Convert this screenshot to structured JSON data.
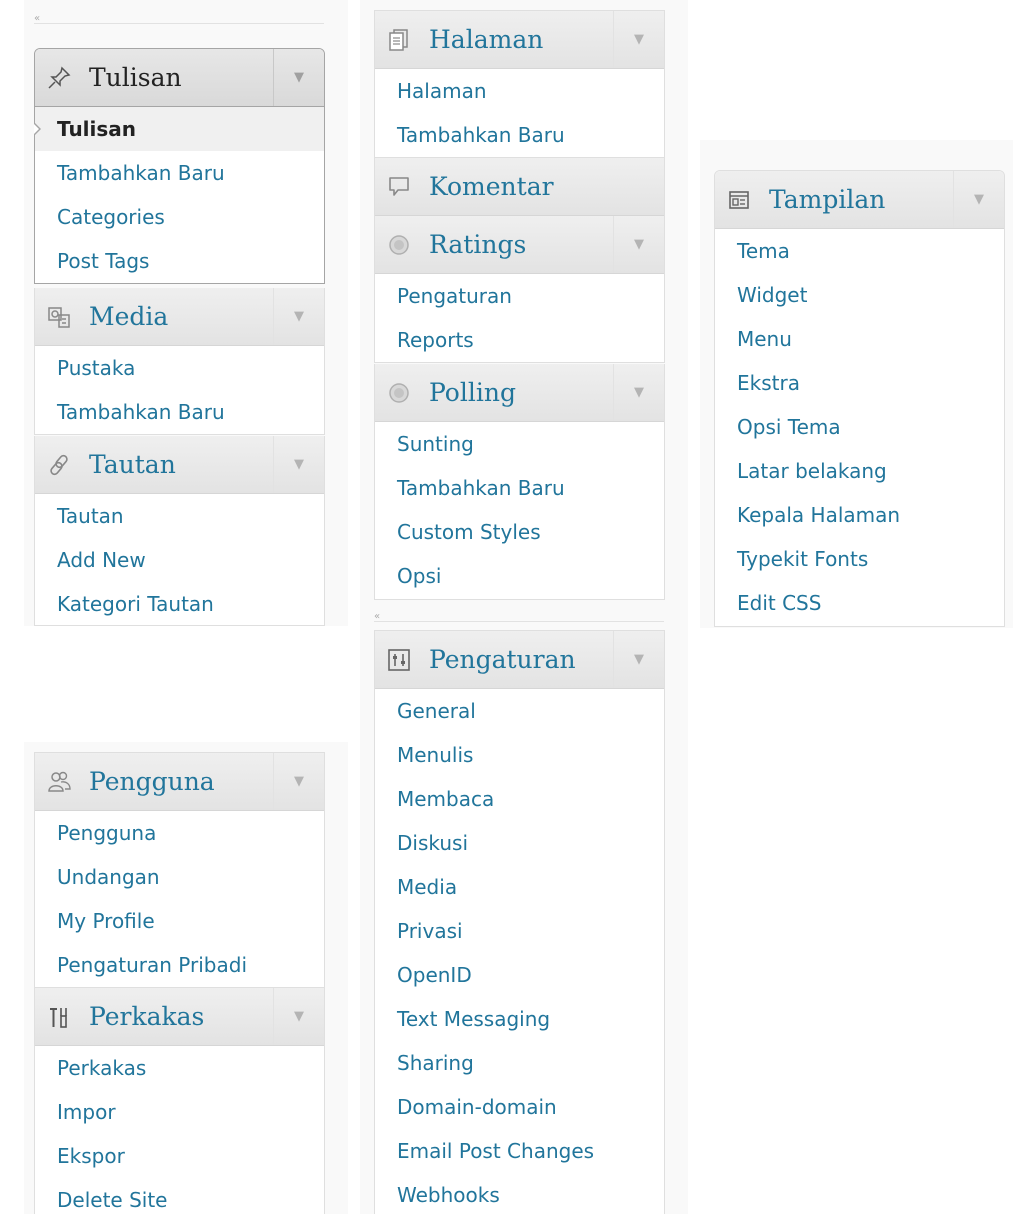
{
  "collapse_symbol": "«",
  "toggle_symbol": "▼",
  "menus": {
    "tulisan": {
      "title": "Tulisan",
      "icon": "pushpin-icon",
      "items": [
        "Tulisan",
        "Tambahkan Baru",
        "Categories",
        "Post Tags"
      ]
    },
    "media": {
      "title": "Media",
      "icon": "media-icon",
      "items": [
        "Pustaka",
        "Tambahkan Baru"
      ]
    },
    "tautan": {
      "title": "Tautan",
      "icon": "link-icon",
      "items": [
        "Tautan",
        "Add New",
        "Kategori Tautan"
      ]
    },
    "halaman": {
      "title": "Halaman",
      "icon": "pages-icon",
      "items": [
        "Halaman",
        "Tambahkan Baru"
      ]
    },
    "komentar": {
      "title": "Komentar",
      "icon": "comment-icon",
      "items": []
    },
    "ratings": {
      "title": "Ratings",
      "icon": "circle-icon",
      "items": [
        "Pengaturan",
        "Reports"
      ]
    },
    "polling": {
      "title": "Polling",
      "icon": "circle-icon",
      "items": [
        "Sunting",
        "Tambahkan Baru",
        "Custom Styles",
        "Opsi"
      ]
    },
    "tampilan": {
      "title": "Tampilan",
      "icon": "appearance-icon",
      "items": [
        "Tema",
        "Widget",
        "Menu",
        "Ekstra",
        "Opsi Tema",
        "Latar belakang",
        "Kepala Halaman",
        "Typekit Fonts",
        "Edit CSS"
      ]
    },
    "pengaturan": {
      "title": "Pengaturan",
      "icon": "settings-icon",
      "items": [
        "General",
        "Menulis",
        "Membaca",
        "Diskusi",
        "Media",
        "Privasi",
        "OpenID",
        "Text Messaging",
        "Sharing",
        "Domain-domain",
        "Email Post Changes",
        "Webhooks"
      ]
    },
    "pengguna": {
      "title": "Pengguna",
      "icon": "users-icon",
      "items": [
        "Pengguna",
        "Undangan",
        "My Profile",
        "Pengaturan Pribadi"
      ]
    },
    "perkakas": {
      "title": "Perkakas",
      "icon": "tools-icon",
      "items": [
        "Perkakas",
        "Impor",
        "Ekspor",
        "Delete Site"
      ]
    }
  }
}
